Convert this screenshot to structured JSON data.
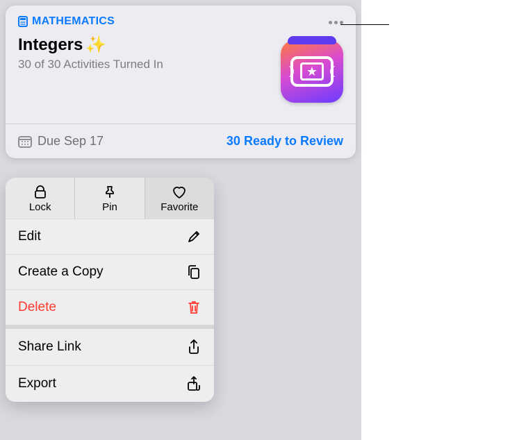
{
  "card": {
    "subject": "MATHEMATICS",
    "title": "Integers",
    "title_emoji": "✨",
    "subtitle": "30 of 30 Activities Turned In",
    "due_label": "Due Sep 17",
    "ready_label": "30 Ready to Review"
  },
  "menu": {
    "top": [
      {
        "label": "Lock",
        "icon": "lock-icon"
      },
      {
        "label": "Pin",
        "icon": "pin-icon"
      },
      {
        "label": "Favorite",
        "icon": "heart-icon"
      }
    ],
    "items": [
      {
        "label": "Edit",
        "icon": "pencil-icon",
        "danger": false
      },
      {
        "label": "Create a Copy",
        "icon": "copy-icon",
        "danger": false
      },
      {
        "label": "Delete",
        "icon": "trash-icon",
        "danger": true
      },
      {
        "label": "Share Link",
        "icon": "share-icon",
        "danger": false,
        "separator": true
      },
      {
        "label": "Export",
        "icon": "export-icon",
        "danger": false
      }
    ]
  },
  "colors": {
    "accent": "#0a7aff",
    "danger": "#ff3b30"
  }
}
